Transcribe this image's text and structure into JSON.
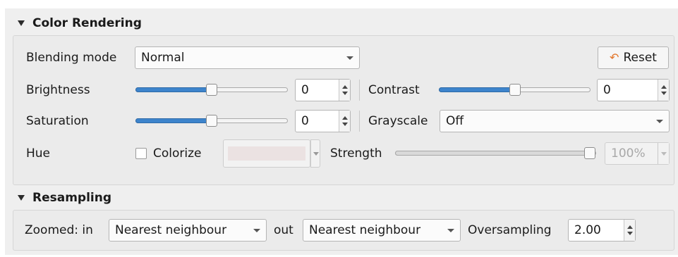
{
  "color_rendering": {
    "title": "Color Rendering",
    "blending_mode": {
      "label": "Blending mode",
      "value": "Normal"
    },
    "reset": {
      "label": "Reset"
    },
    "brightness": {
      "label": "Brightness",
      "value": "0",
      "slider_fraction": 0.5
    },
    "contrast": {
      "label": "Contrast",
      "value": "0",
      "slider_fraction": 0.5
    },
    "saturation": {
      "label": "Saturation",
      "value": "0",
      "slider_fraction": 0.5
    },
    "grayscale": {
      "label": "Grayscale",
      "value": "Off"
    },
    "hue": {
      "label": "Hue",
      "colorize_label": "Colorize",
      "colorize_checked": false,
      "color_swatch": "#ebe2e2",
      "strength_label": "Strength",
      "strength_value": "100%",
      "strength_fraction": 1.0
    }
  },
  "resampling": {
    "title": "Resampling",
    "zoomed_in_label": "Zoomed: in",
    "zoomed_in_value": "Nearest neighbour",
    "zoomed_out_label": "out",
    "zoomed_out_value": "Nearest neighbour",
    "oversampling_label": "Oversampling",
    "oversampling_value": "2.00"
  },
  "colors": {
    "accent": "#3d84cc",
    "reset_icon": "#e2762b"
  }
}
